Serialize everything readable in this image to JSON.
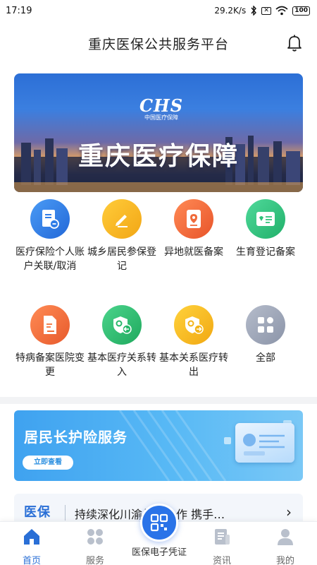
{
  "status_bar": {
    "time": "17:19",
    "network_speed": "29.2K/s",
    "battery": "100",
    "x_box": "✕",
    "icons": [
      "bluetooth-icon",
      "sim-disabled-icon",
      "wifi-icon",
      "battery-icon"
    ]
  },
  "header": {
    "title": "重庆医保公共服务平台",
    "bell_icon": "bell-icon"
  },
  "banner": {
    "logo_text": "CHS",
    "logo_subtitle": "中国医疗保障",
    "title": "重庆医疗保障"
  },
  "services": [
    {
      "label": "医疗保险个人账户关联/取消",
      "icon": "document-link-icon",
      "color": "#2f7de8"
    },
    {
      "label": "城乡居民参保登记",
      "icon": "edit-pencil-icon",
      "color": "#f5b51e"
    },
    {
      "label": "异地就医备案",
      "icon": "location-card-icon",
      "color": "#f06a3a"
    },
    {
      "label": "生育登记备案",
      "icon": "id-card-icon",
      "color": "#2fc27a"
    },
    {
      "label": "特病备案医院变更",
      "icon": "document-edit-icon",
      "color": "#f07038"
    },
    {
      "label": "基本医疗关系转入",
      "icon": "shield-transfer-in-icon",
      "color": "#27b86a"
    },
    {
      "label": "基本关系医疗转出",
      "icon": "shield-transfer-out-icon",
      "color": "#f3b417"
    },
    {
      "label": "全部",
      "icon": "grid-all-icon",
      "color": "#9aa3b5"
    }
  ],
  "promo": {
    "title": "居民长护险服务",
    "button_label": "立即查看"
  },
  "news": {
    "tag": "医保",
    "text": "持续深化川渝战略合作 携手…"
  },
  "tabbar": {
    "items": [
      {
        "label": "首页",
        "icon": "home-icon",
        "active": true
      },
      {
        "label": "服务",
        "icon": "services-icon",
        "active": false
      },
      {
        "label": "资讯",
        "icon": "news-icon",
        "active": false
      },
      {
        "label": "我的",
        "icon": "profile-icon",
        "active": false
      }
    ],
    "center_label": "医保电子凭证",
    "center_icon": "qr-code-icon"
  },
  "colors": {
    "accent": "#2a6fd6",
    "inactive": "#9aa3b5"
  }
}
